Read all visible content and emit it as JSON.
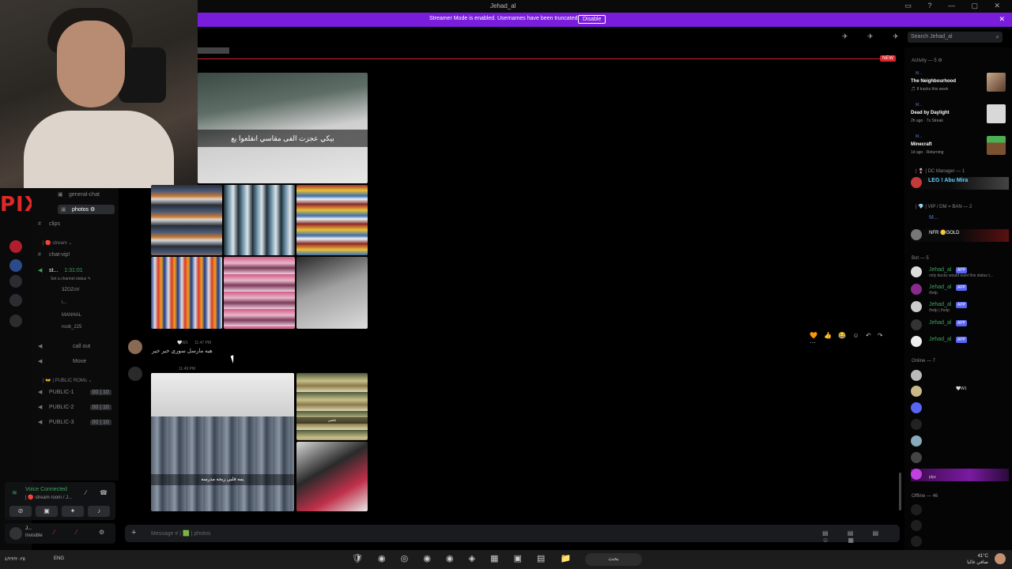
{
  "window": {
    "title": "Jehad_al",
    "controls": "▭ ? — ▢ ✕"
  },
  "banner": {
    "message": "Streamer Mode is enabled. Usernames have been truncated.",
    "disable_label": "Disable",
    "close": "✕"
  },
  "topbar": {
    "icons": "✈ ✈ ✈ ♟",
    "search_placeholder": "Search Jehad_al",
    "search_icon": "⌕"
  },
  "rail": {
    "logo_text": "PIXL"
  },
  "channels": {
    "general_chat": "general-chat",
    "photos": "photos",
    "clips": "clips",
    "cat_stream": "| 🔴 stream ⌄",
    "chat_vip": "chat-vip!",
    "stage": "st...",
    "stage_timer": "1:31:01",
    "set_status": "Set a channel status ✎",
    "voice_users": [
      "3ZOZoV",
      "i...",
      "MANHAL",
      "roob_225"
    ],
    "call_out": "call out",
    "move": "Move",
    "cat_public": "| 👐 | PUBLIC ROMs ⌄",
    "public": [
      {
        "name": "PUBLIC-1",
        "limit": "00 | 10"
      },
      {
        "name": "PUBLIC-2",
        "limit": "00 | 10"
      },
      {
        "name": "PUBLIC-3",
        "limit": "00 | 10"
      }
    ]
  },
  "voice": {
    "status": "Voice Connected",
    "room": "| 🔴 stream room / J...",
    "user_status": "Invisible",
    "user_name": "J..."
  },
  "chat": {
    "new_tag": "NEW",
    "caption_top": "بيكي عجزت الفى مقاسي انقلعوا يع",
    "msg1": {
      "badge": "🤍W1",
      "time": "11:47 PM",
      "text": "هيه مارسل سوري خير خير"
    },
    "msg2": {
      "time": "11:49 PM"
    },
    "caption_skirts": "يمه قلبي ريحه مدرسه",
    "caption_small": "بائعتين",
    "reactions": "🧡 👍 😂 ☺ ↶ ↷ ⋯",
    "composer_placeholder": "Message # | 🟩 | photos",
    "composer_plus": "+",
    "composer_icons": "▤ ▤ ▤ ☺ ▦"
  },
  "members": {
    "activity_header": "Activity — 5 ⚙",
    "activities": [
      {
        "user": "M...",
        "name": "The Neighbourhood",
        "sub": "🎵 8 tracks this week"
      },
      {
        "user": "M...",
        "name": "Dead by Daylight",
        "sub": "2h ago · 7s Streak"
      },
      {
        "user": "M...",
        "name": "Minecraft",
        "sub": "1d ago · Returning"
      }
    ],
    "dc_manager": "| 🍷 | DC Manager — 1",
    "dc_member": "LEG ! Abu Mira",
    "vip_header": "| 💎 | VIP / DM = BAN — 2",
    "vip_user": "M...",
    "vip_nfr": "NFR 🪙GOLD",
    "bot_header": "Bot — 5",
    "app_tag": "APP",
    "bots": [
      {
        "name": "Jehad_al",
        "desc": "only ducks would want this status t..."
      },
      {
        "name": "Jehad_al",
        "desc": "/help"
      },
      {
        "name": "Jehad_al",
        "desc": "/help | /help"
      },
      {
        "name": "Jehad_al",
        "desc": ""
      },
      {
        "name": "Jehad_al",
        "desc": ""
      }
    ],
    "online_header": "Online — 7",
    "online_badge": "🤍W1",
    "online_status": "plyz",
    "offline_header": "Offline — 46"
  },
  "taskbar": {
    "lang": "ENG",
    "date_left": "٤/٢٣/٢٠٢٥",
    "search": "بحث",
    "apps": "🛡 ◉ ◎ ◉ ◉ ◈ ▦ ▣ ▤ 📁 ▢ ▬",
    "weather": "41°C",
    "weather_sub": "صافي غالبا"
  }
}
